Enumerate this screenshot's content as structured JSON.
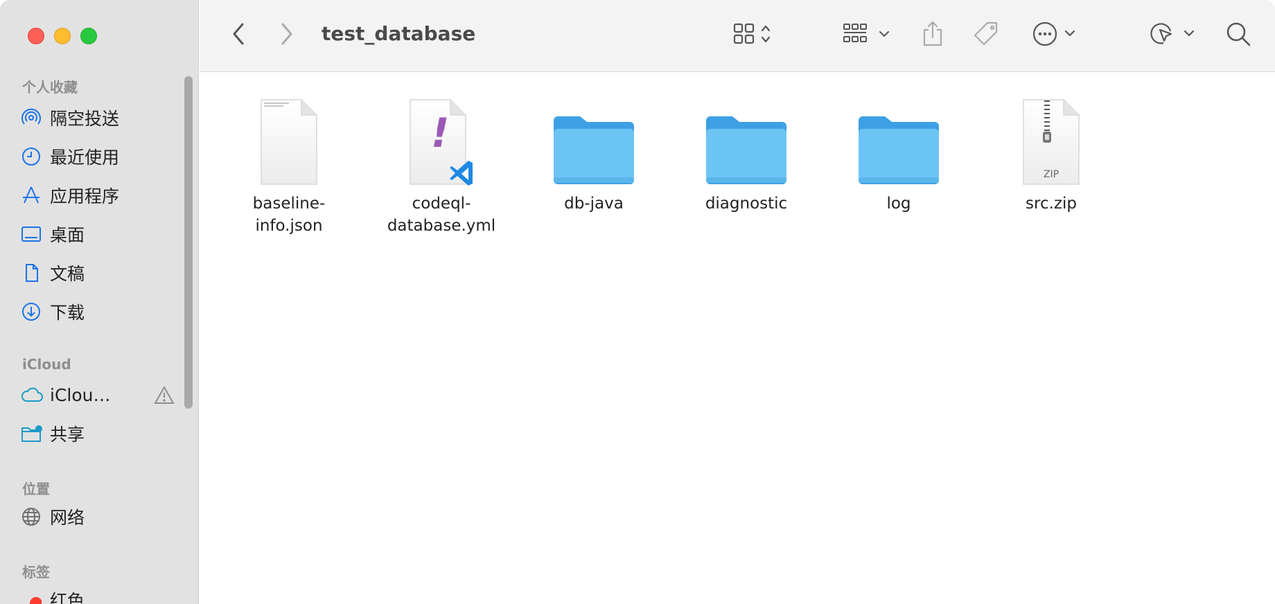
{
  "window": {
    "title": "test_database"
  },
  "sidebar": {
    "sections": {
      "favorites": "个人收藏",
      "icloud": "iCloud",
      "locations": "位置",
      "tags": "标签"
    },
    "favorites": [
      {
        "label": "隔空投送",
        "icon": "airdrop-icon"
      },
      {
        "label": "最近使用",
        "icon": "clock-icon"
      },
      {
        "label": "应用程序",
        "icon": "applications-icon"
      },
      {
        "label": "桌面",
        "icon": "desktop-icon"
      },
      {
        "label": "文稿",
        "icon": "document-icon"
      },
      {
        "label": "下载",
        "icon": "download-icon"
      }
    ],
    "icloud": [
      {
        "label": "iClou…",
        "icon": "cloud-icon"
      },
      {
        "label": "共享",
        "icon": "shared-folder-icon"
      }
    ],
    "locations": [
      {
        "label": "网络",
        "icon": "globe-icon"
      }
    ],
    "tags": [
      {
        "label": "红色",
        "icon": "red-tag-icon",
        "color": "#ff3b30"
      }
    ]
  },
  "toolbar": {
    "back": "chevron-left-icon",
    "forward": "chevron-right-icon",
    "view": "grid-view-icon",
    "group": "group-icon",
    "share": "share-icon",
    "tag": "tag-icon",
    "more": "more-icon",
    "markup": "markup-icon",
    "search": "search-icon"
  },
  "files": [
    {
      "name": "baseline-info.json",
      "type": "json"
    },
    {
      "name": "codeql-database.yml",
      "type": "yml"
    },
    {
      "name": "db-java",
      "type": "folder"
    },
    {
      "name": "diagnostic",
      "type": "folder"
    },
    {
      "name": "log",
      "type": "folder"
    },
    {
      "name": "src.zip",
      "type": "zip",
      "badge": "ZIP"
    }
  ],
  "colors": {
    "accent": "#1a73e8",
    "folder": "#6cc4f5"
  }
}
